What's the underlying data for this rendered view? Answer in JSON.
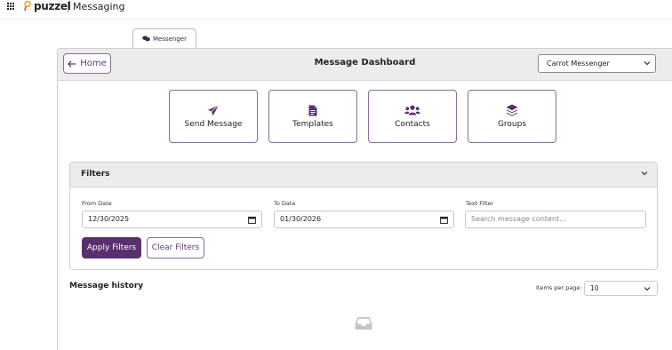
{
  "app": {
    "brand": "puzzel",
    "title": "Messaging"
  },
  "tabs": [
    {
      "label": "Messenger",
      "icon": "chat-bubbles-icon",
      "active": true
    }
  ],
  "header": {
    "home_label": "Home",
    "title": "Message Dashboard",
    "messenger_select": {
      "value": "Carrot Messenger"
    }
  },
  "actions": [
    {
      "label": "Send Message",
      "icon": "paper-plane-icon"
    },
    {
      "label": "Templates",
      "icon": "document-icon"
    },
    {
      "label": "Contacts",
      "icon": "users-icon"
    },
    {
      "label": "Groups",
      "icon": "layers-icon"
    }
  ],
  "filters": {
    "title": "Filters",
    "from_label": "From Date",
    "from_value": "12/30/2025",
    "to_label": "To Date",
    "to_value": "01/30/2026",
    "text_label": "Text Filter",
    "text_placeholder": "Search message content...",
    "apply_label": "Apply Filters",
    "clear_label": "Clear Filters"
  },
  "history": {
    "title": "Message history",
    "items_per_page_label": "Items per page:",
    "items_per_page_value": "10",
    "empty_icon": "inbox-icon"
  },
  "colors": {
    "accent": "#5a2f6e",
    "accent_border": "#8a6b9a",
    "header_bg": "#ececec"
  }
}
